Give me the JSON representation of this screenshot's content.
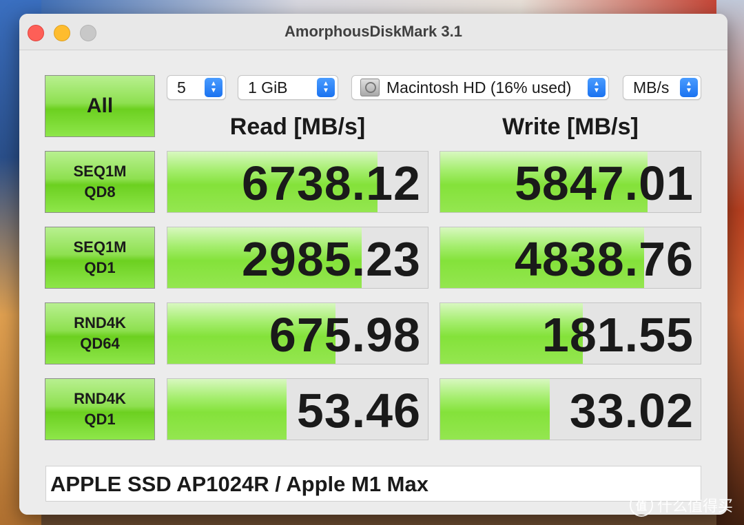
{
  "window": {
    "title": "AmorphousDiskMark 3.1"
  },
  "controls": {
    "all_label": "All",
    "count": "5",
    "size": "1 GiB",
    "disk": "Macintosh HD (16% used)",
    "unit": "MB/s"
  },
  "headers": {
    "read": "Read [MB/s]",
    "write": "Write [MB/s]"
  },
  "tests": [
    {
      "line1": "SEQ1M",
      "line2": "QD8",
      "read": "6738.12",
      "write": "5847.01",
      "read_fill": 0.807,
      "write_fill": 0.797
    },
    {
      "line1": "SEQ1M",
      "line2": "QD1",
      "read": "2985.23",
      "write": "4838.76",
      "read_fill": 0.746,
      "write_fill": 0.784
    },
    {
      "line1": "RND4K",
      "line2": "QD64",
      "read": "675.98",
      "write": "181.55",
      "read_fill": 0.645,
      "write_fill": 0.547
    },
    {
      "line1": "RND4K",
      "line2": "QD1",
      "read": "53.46",
      "write": "33.02",
      "read_fill": 0.458,
      "write_fill": 0.421
    }
  ],
  "footer": {
    "text": "APPLE SSD AP1024R / Apple M1 Max"
  },
  "watermark": {
    "text": "什么值得买",
    "logo": "值"
  }
}
